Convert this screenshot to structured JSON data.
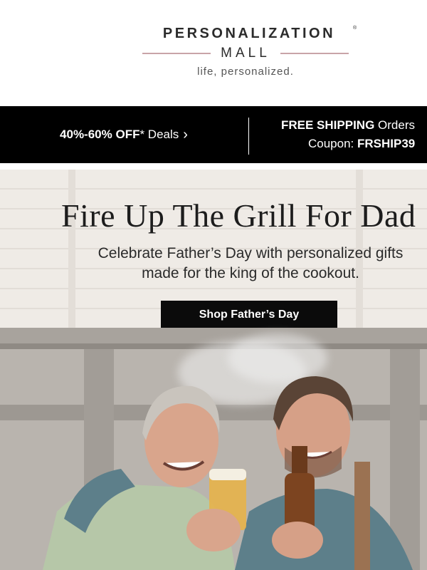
{
  "logo": {
    "brand_top": "PERSONALIZATION",
    "registered_mark": "®",
    "brand_bottom": "MALL",
    "tagline": "life, personalized."
  },
  "promo": {
    "deals_bold": "40%-60% OFF",
    "deals_rest": "* Deals",
    "chevron_icon": "chevron-right-icon",
    "shipping_bold": "FREE SHIPPING",
    "shipping_rest": " Orders",
    "coupon_label": "Coupon: ",
    "coupon_code": "FRSHIP39"
  },
  "hero": {
    "title": "Fire Up The Grill For Dad",
    "subtitle_line1": "Celebrate Father’s Day with personalized gifts",
    "subtitle_line2": "made for the king of the cookout.",
    "cta": "Shop Father’s Day"
  },
  "colors": {
    "promo_bar": "#000000",
    "cta_button": "#0b0b0b",
    "logo_accent": "#c9a4a8"
  }
}
